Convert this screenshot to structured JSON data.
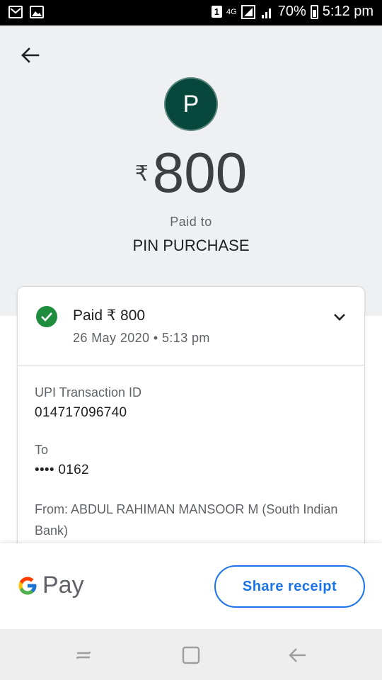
{
  "status_bar": {
    "sim_badge": "1",
    "network": "4G",
    "battery": "70%",
    "time": "5:12 pm"
  },
  "header": {
    "avatar_letter": "P",
    "currency_symbol": "₹",
    "amount": "800",
    "paid_to_label": "Paid to",
    "payee_name": "PIN PURCHASE"
  },
  "status": {
    "title": "Paid ₹ 800",
    "datetime": "26 May 2020 • 5:13 pm"
  },
  "details": {
    "upi_label": "UPI Transaction ID",
    "upi_value": "014717096740",
    "to_label": "To",
    "to_value": "•••• 0162",
    "from_text": "From: ABDUL RAHIMAN MANSOOR M (South Indian Bank)"
  },
  "bottom": {
    "brand_pay": "Pay",
    "share_label": "Share receipt"
  },
  "colors": {
    "accent": "#1a73e8",
    "avatar_bg": "#08483c",
    "success": "#1e8e3e"
  },
  "icons": [
    "back-arrow-icon",
    "check-circle-icon",
    "chevron-down-icon",
    "google-g-icon",
    "nav-recents-icon",
    "nav-home-icon",
    "nav-back-icon"
  ]
}
